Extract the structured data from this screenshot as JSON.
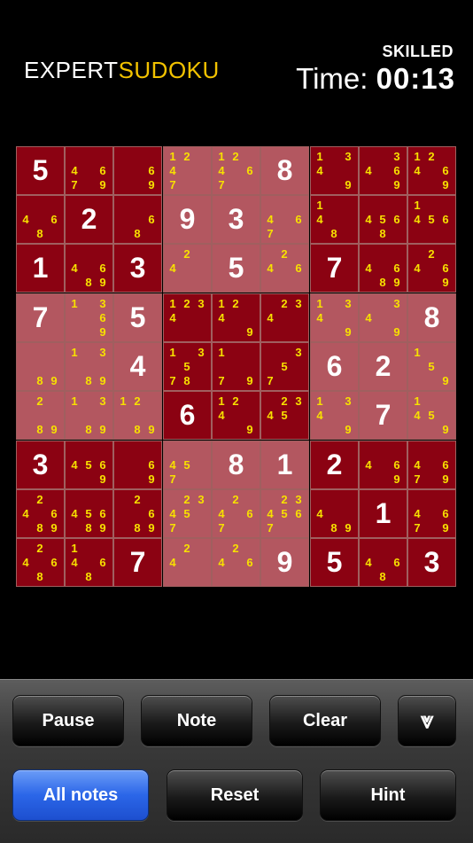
{
  "header": {
    "logo_expert": "EXPERT",
    "logo_sudoku": "SUDOKU",
    "level": "SKILLED",
    "time_label": "Time:",
    "time_value": "00:13"
  },
  "board": {
    "rows": [
      [
        {
          "v": "5"
        },
        {
          "n": [
            "",
            "",
            "",
            "4",
            "",
            "6",
            "7",
            "",
            "9"
          ]
        },
        {
          "n": [
            "",
            "",
            "",
            "",
            "",
            "6",
            "",
            "",
            "9"
          ]
        },
        {
          "n": [
            "1",
            "2",
            "",
            "4",
            "",
            "",
            "7",
            "",
            ""
          ]
        },
        {
          "n": [
            "1",
            "2",
            "",
            "4",
            "",
            "6",
            "7",
            "",
            ""
          ]
        },
        {
          "v": "8"
        },
        {
          "n": [
            "1",
            "",
            "3",
            "4",
            "",
            "",
            "",
            "",
            "9"
          ]
        },
        {
          "n": [
            "",
            "",
            "3",
            "4",
            "",
            "6",
            "",
            "",
            "9"
          ]
        },
        {
          "n": [
            "1",
            "2",
            "",
            "4",
            "",
            "6",
            "",
            "",
            "9"
          ]
        }
      ],
      [
        {
          "n": [
            "",
            "",
            "",
            "4",
            "",
            "6",
            "",
            "8",
            ""
          ]
        },
        {
          "v": "2"
        },
        {
          "n": [
            "",
            "",
            "",
            "",
            "",
            "6",
            "",
            "8",
            ""
          ]
        },
        {
          "v": "9"
        },
        {
          "v": "3"
        },
        {
          "n": [
            "",
            "",
            "",
            "4",
            "",
            "6",
            "7",
            "",
            ""
          ]
        },
        {
          "n": [
            "1",
            "",
            "",
            "4",
            "",
            "",
            "",
            "8",
            ""
          ]
        },
        {
          "n": [
            "",
            "",
            "",
            "4",
            "5",
            "6",
            "",
            "8",
            ""
          ]
        },
        {
          "n": [
            "1",
            "",
            "",
            "4",
            "5",
            "6",
            "",
            "",
            ""
          ]
        }
      ],
      [
        {
          "v": "1"
        },
        {
          "n": [
            "",
            "",
            "",
            "4",
            "",
            "6",
            "",
            "8",
            "9"
          ]
        },
        {
          "v": "3"
        },
        {
          "n": [
            "",
            "2",
            "",
            "4",
            "",
            "",
            "",
            "",
            ""
          ]
        },
        {
          "v": "5"
        },
        {
          "n": [
            "",
            "2",
            "",
            "4",
            "",
            "6",
            "",
            "",
            ""
          ]
        },
        {
          "v": "7"
        },
        {
          "n": [
            "",
            "",
            "",
            "4",
            "",
            "6",
            "",
            "8",
            "9"
          ]
        },
        {
          "n": [
            "",
            "2",
            "",
            "4",
            "",
            "6",
            "",
            "",
            "9"
          ]
        }
      ],
      [
        {
          "v": "7"
        },
        {
          "n": [
            "1",
            "",
            "3",
            "",
            "",
            "6",
            "",
            "",
            "9"
          ]
        },
        {
          "v": "5"
        },
        {
          "n": [
            "1",
            "2",
            "3",
            "4",
            "",
            "",
            "",
            "",
            ""
          ]
        },
        {
          "n": [
            "1",
            "2",
            "",
            "4",
            "",
            "",
            "",
            "",
            "9"
          ]
        },
        {
          "n": [
            "",
            "2",
            "3",
            "4",
            "",
            "",
            "",
            "",
            ""
          ]
        },
        {
          "n": [
            "1",
            "",
            "3",
            "4",
            "",
            "",
            "",
            "",
            "9"
          ]
        },
        {
          "n": [
            "",
            "",
            "3",
            "4",
            "",
            "",
            "",
            "",
            "9"
          ]
        },
        {
          "v": "8"
        }
      ],
      [
        {
          "n": [
            "",
            "",
            "",
            "",
            "",
            "",
            "",
            "8",
            "9"
          ]
        },
        {
          "n": [
            "1",
            "",
            "3",
            "",
            "",
            "",
            "",
            "8",
            "9"
          ]
        },
        {
          "v": "4"
        },
        {
          "n": [
            "1",
            "",
            "3",
            "",
            "5",
            "",
            "7",
            "8",
            ""
          ]
        },
        {
          "n": [
            "1",
            "",
            "",
            "",
            "",
            "",
            "7",
            "",
            "9"
          ]
        },
        {
          "n": [
            "",
            "",
            "3",
            "",
            "5",
            "",
            "7",
            "",
            ""
          ]
        },
        {
          "v": "6"
        },
        {
          "v": "2"
        },
        {
          "n": [
            "1",
            "",
            "",
            "",
            "5",
            "",
            "",
            "",
            "9"
          ]
        }
      ],
      [
        {
          "n": [
            "",
            "2",
            "",
            "",
            "",
            "",
            "",
            "8",
            "9"
          ]
        },
        {
          "n": [
            "1",
            "",
            "3",
            "",
            "",
            "",
            "",
            "8",
            "9"
          ]
        },
        {
          "n": [
            "1",
            "2",
            "",
            "",
            "",
            "",
            "",
            "8",
            "9"
          ]
        },
        {
          "v": "6"
        },
        {
          "n": [
            "1",
            "2",
            "",
            "4",
            "",
            "",
            "",
            "",
            "9"
          ]
        },
        {
          "n": [
            "",
            "2",
            "3",
            "4",
            "5",
            "",
            "",
            "",
            ""
          ]
        },
        {
          "n": [
            "1",
            "",
            "3",
            "4",
            "",
            "",
            "",
            "",
            "9"
          ]
        },
        {
          "v": "7"
        },
        {
          "n": [
            "1",
            "",
            "",
            "4",
            "5",
            "",
            "",
            "",
            "9"
          ]
        }
      ],
      [
        {
          "v": "3"
        },
        {
          "n": [
            "",
            "",
            "",
            "4",
            "5",
            "6",
            "",
            "",
            "9"
          ]
        },
        {
          "n": [
            "",
            "",
            "",
            "",
            "",
            "6",
            "",
            "",
            "9"
          ]
        },
        {
          "n": [
            "",
            "",
            "",
            "4",
            "5",
            "",
            "7",
            "",
            ""
          ]
        },
        {
          "v": "8"
        },
        {
          "v": "1"
        },
        {
          "v": "2"
        },
        {
          "n": [
            "",
            "",
            "",
            "4",
            "",
            "6",
            "",
            "",
            "9"
          ]
        },
        {
          "n": [
            "",
            "",
            "",
            "4",
            "",
            "6",
            "7",
            "",
            "9"
          ]
        }
      ],
      [
        {
          "n": [
            "",
            "2",
            "",
            "4",
            "",
            "6",
            "",
            "8",
            "9"
          ]
        },
        {
          "n": [
            "",
            "",
            "",
            "4",
            "5",
            "6",
            "",
            "8",
            "9"
          ]
        },
        {
          "n": [
            "",
            "2",
            "",
            "",
            "",
            "6",
            "",
            "8",
            "9"
          ]
        },
        {
          "n": [
            "",
            "2",
            "3",
            "4",
            "5",
            "",
            "7",
            "",
            ""
          ]
        },
        {
          "n": [
            "",
            "2",
            "",
            "4",
            "",
            "6",
            "7",
            "",
            ""
          ]
        },
        {
          "n": [
            "",
            "2",
            "3",
            "4",
            "5",
            "6",
            "7",
            "",
            ""
          ]
        },
        {
          "n": [
            "",
            "",
            "",
            "4",
            "",
            "",
            "",
            "8",
            "9"
          ]
        },
        {
          "v": "1"
        },
        {
          "n": [
            "",
            "",
            "",
            "4",
            "",
            "6",
            "7",
            "",
            "9"
          ]
        }
      ],
      [
        {
          "n": [
            "",
            "2",
            "",
            "4",
            "",
            "6",
            "",
            "8",
            ""
          ]
        },
        {
          "n": [
            "1",
            "",
            "",
            "4",
            "",
            "6",
            "",
            "8",
            ""
          ]
        },
        {
          "v": "7"
        },
        {
          "n": [
            "",
            "2",
            "",
            "4",
            "",
            "",
            "",
            "",
            ""
          ]
        },
        {
          "n": [
            "",
            "2",
            "",
            "4",
            "",
            "6",
            "",
            "",
            ""
          ]
        },
        {
          "v": "9"
        },
        {
          "v": "5"
        },
        {
          "n": [
            "",
            "",
            "",
            "4",
            "",
            "6",
            "",
            "8",
            ""
          ]
        },
        {
          "v": "3"
        }
      ]
    ]
  },
  "buttons": {
    "pause": "Pause",
    "note": "Note",
    "clear": "Clear",
    "collapse_icon": "double-chevron-down-icon",
    "collapse_glyph": "⩔",
    "all_notes": "All notes",
    "reset": "Reset",
    "hint": "Hint"
  },
  "colors": {
    "cell_dark": "#8b0212",
    "cell_light": "#b35760",
    "note": "#f7e000",
    "active_button": "#2b66e8"
  }
}
